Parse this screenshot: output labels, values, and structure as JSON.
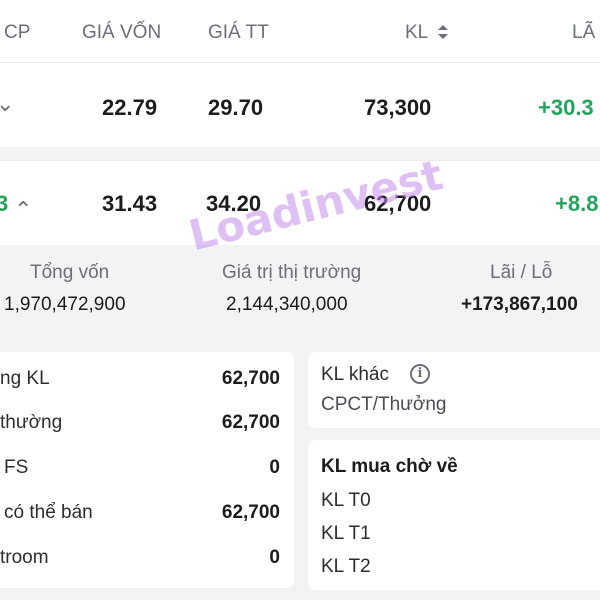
{
  "header": {
    "col_cp": "CP",
    "col_gia_von": "GIÁ VỐN",
    "col_gia_tt": "GIÁ TT",
    "col_kl": "KL",
    "col_lai": "LÃ"
  },
  "rows": [
    {
      "ticker_tail": "",
      "chevron": "⌄",
      "gia_von": "22.79",
      "gia_tt": "29.70",
      "kl": "73,300",
      "lai": "+30.3"
    },
    {
      "ticker_tail": "3",
      "chevron": "⌃",
      "gia_von": "31.43",
      "gia_tt": "34.20",
      "kl": "62,700",
      "lai": "+8.8"
    }
  ],
  "summary": {
    "tong_von_label": "Tổng vốn",
    "tong_von_value": "1,970,472,900",
    "gia_tri_label": "Giá trị thị trường",
    "gia_tri_value": "2,144,340,000",
    "lai_lo_label": "Lãi / Lỗ",
    "lai_lo_value": "+173,867,100"
  },
  "left_card": {
    "items": [
      {
        "label": "ng KL",
        "value": "62,700"
      },
      {
        "label": "thường",
        "value": "62,700"
      },
      {
        "label": "FS",
        "value": "0"
      },
      {
        "label": "có thể bán",
        "value": "62,700"
      },
      {
        "label": "troom",
        "value": "0"
      }
    ]
  },
  "right_card_top": {
    "label": "KL khác",
    "sub": "CPCT/Thưởng",
    "info_icon": "i"
  },
  "right_card_bottom": {
    "title": "KL mua chờ về",
    "items": [
      "KL T0",
      "KL T1",
      "KL T2"
    ]
  },
  "watermark": "Loadinvest",
  "colors": {
    "green": "#22a45d",
    "watermark": "#c48cec"
  }
}
